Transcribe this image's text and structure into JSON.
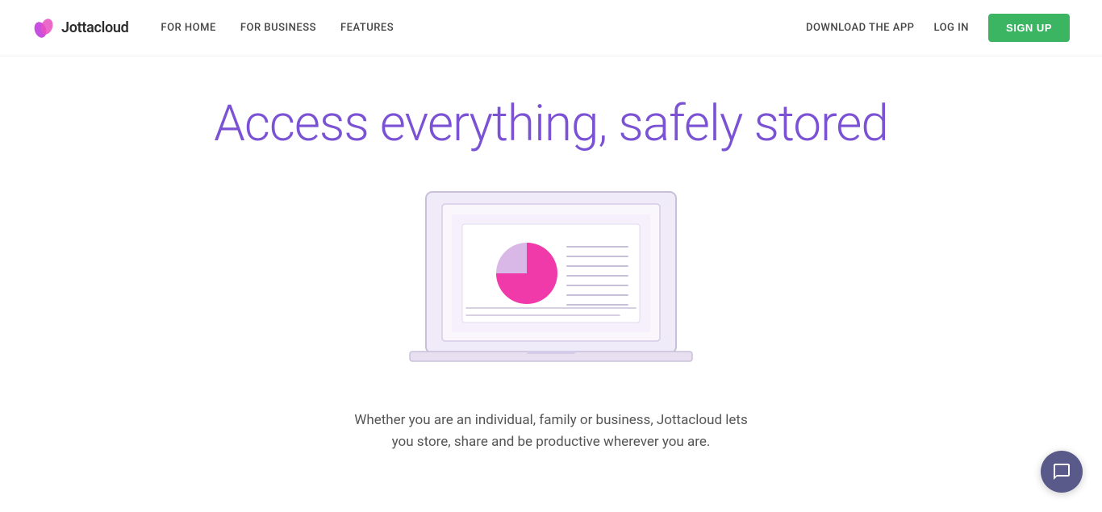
{
  "navbar": {
    "logo_text": "Jottacloud",
    "nav_items": [
      {
        "label": "FOR HOME",
        "id": "for-home"
      },
      {
        "label": "FOR BUSINESS",
        "id": "for-business"
      },
      {
        "label": "FEATURES",
        "id": "features"
      }
    ],
    "download_label": "DOWNLOAD THE APP",
    "login_label": "LOG IN",
    "signup_label": "SIGN UP"
  },
  "hero": {
    "title": "Access everything, safely stored",
    "subtext_line1": "Whether you are an individual, family or business, Jottacloud lets",
    "subtext_line2": "you store, share and be productive wherever you are."
  },
  "chart": {
    "filled_color": "#f03aaa",
    "empty_color": "#d9b8e8",
    "filled_percent": 75
  },
  "colors": {
    "accent_purple": "#7b52d4",
    "accent_pink": "#f03aaa",
    "accent_lavender": "#d9b8e8",
    "signup_green": "#3cb563",
    "nav_text": "#444444",
    "laptop_outline": "#c8c0d8",
    "laptop_fill": "#f0ebf8"
  }
}
